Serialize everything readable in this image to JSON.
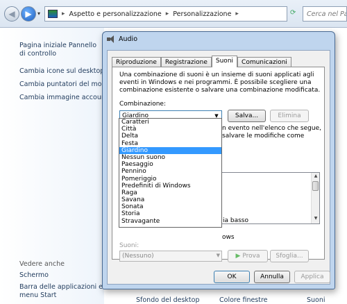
{
  "explorer": {
    "breadcrumb": [
      "Aspetto e personalizzazione",
      "Personalizzazione"
    ],
    "search_placeholder": "Cerca nel Panni"
  },
  "leftpane": {
    "links": [
      "Pagina iniziale Pannello di controllo",
      "Cambia icone sul desktop",
      "Cambia puntatori del mouse",
      "Cambia immagine account"
    ],
    "see_also_header": "Vedere anche",
    "see_also": [
      "Schermo",
      "Barra delle applicazioni e menu Start"
    ]
  },
  "bottom_strip": [
    "Sfondo del desktop",
    "Colore finestre",
    "Suoni"
  ],
  "dialog": {
    "title": "Audio",
    "tabs": [
      "Riproduzione",
      "Registrazione",
      "Suoni",
      "Comunicazioni"
    ],
    "active_tab": "Suoni",
    "description": "Una combinazione di suoni è un insieme di suoni applicati agli eventi in Windows e nei programmi. È possibile scegliere una combinazione esistente o salvare una combinazione modificata.",
    "combination_label": "Combinazione:",
    "combination_value": "Giardino",
    "save_button": "Salva...",
    "delete_button": "Elimina",
    "partial_text_1": "n evento nell'elenco che segue,",
    "partial_text_2": "salvare le modifiche come",
    "partial_event": "ia basso",
    "partial_checkbox": "ows",
    "sounds_label": "Suoni:",
    "sounds_value": "(Nessuno)",
    "test_button": "Prova",
    "browse_button": "Sfoglia...",
    "ok_button": "OK",
    "cancel_button": "Annulla",
    "apply_button": "Applica",
    "dropdown_options": [
      "Caratteri",
      "Città",
      "Delta",
      "Festa",
      "Giardino",
      "Nessun suono",
      "Paesaggio",
      "Pennino",
      "Pomeriggio",
      "Predefiniti di Windows",
      "Raga",
      "Savana",
      "Sonata",
      "Storia",
      "Stravagante"
    ],
    "dropdown_selected": "Giardino"
  }
}
